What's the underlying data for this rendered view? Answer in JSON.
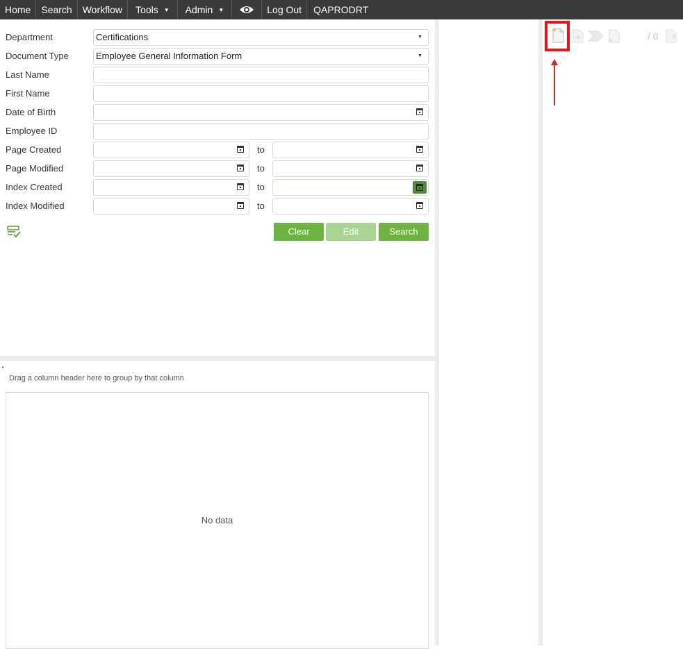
{
  "nav": {
    "home": "Home",
    "search": "Search",
    "workflow": "Workflow",
    "tools": "Tools",
    "admin": "Admin",
    "logout": "Log Out",
    "user": "QAPRODRT"
  },
  "form": {
    "department_label": "Department",
    "department_value": "Certifications",
    "doctype_label": "Document Type",
    "doctype_value": "Employee General Information Form",
    "lastname_label": "Last Name",
    "firstname_label": "First Name",
    "dob_label": "Date of Birth",
    "empid_label": "Employee ID",
    "page_created_label": "Page Created",
    "page_modified_label": "Page Modified",
    "index_created_label": "Index Created",
    "index_modified_label": "Index Modified",
    "to": "to"
  },
  "buttons": {
    "clear": "Clear",
    "edit": "Edit",
    "search": "Search"
  },
  "grid": {
    "group_hint": "Drag a column header here to group by that column",
    "empty": "No data"
  },
  "viewer": {
    "page_count": "/ 0"
  },
  "colors": {
    "accent_green": "#6db33f",
    "disabled_green": "#a9d592",
    "highlight_red": "#e11111",
    "nav_bg": "#3a3a3a"
  }
}
